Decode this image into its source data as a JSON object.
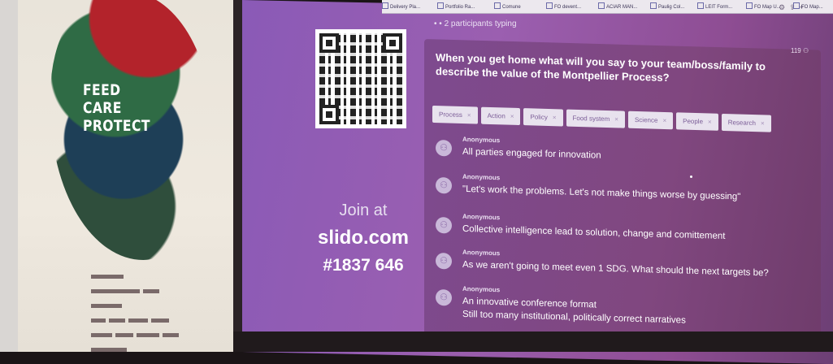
{
  "poster": {
    "slogan_lines": [
      "FEED",
      "CARE",
      "PROTECT"
    ]
  },
  "browser": {
    "bookmarks": [
      "Delivery Pla...",
      "Portfolio Ra...",
      "Comune",
      "FO devent...",
      "ACIAR MAN...",
      "Paulig Col...",
      "LEIT Form...",
      "FO Map U...",
      "FO Map..."
    ]
  },
  "slido": {
    "typing_status": "2 participants typing",
    "response_count": "119",
    "question": "When you get home what will you say to your team/boss/family to describe the value of the Montpellier Process?",
    "join": {
      "line1": "Join at",
      "site": "slido.com",
      "code": "#1837 646"
    },
    "tags": [
      "Process",
      "Action",
      "Policy",
      "Food system",
      "Science",
      "People",
      "Research"
    ],
    "tag_remove_glyph": "×",
    "responses": [
      {
        "author": "Anonymous",
        "lines": [
          "All parties engaged for innovation"
        ]
      },
      {
        "author": "Anonymous",
        "lines": [
          "\"Let's work the problems. Let's not make things worse by guessing\""
        ]
      },
      {
        "author": "Anonymous",
        "lines": [
          "Collective intelligence lead to solution, change and comittement"
        ]
      },
      {
        "author": "Anonymous",
        "lines": [
          "As we aren't going to meet even 1 SDG. What should the next targets be?"
        ]
      },
      {
        "author": "Anonymous",
        "lines": [
          "An innovative conference format",
          "Still too many institutional, politically correct narratives"
        ]
      }
    ]
  },
  "colors": {
    "screen_purple": "#8a5ab7",
    "panel_purple": "#7e4a8f",
    "tag_bg": "#e8e2ee"
  }
}
